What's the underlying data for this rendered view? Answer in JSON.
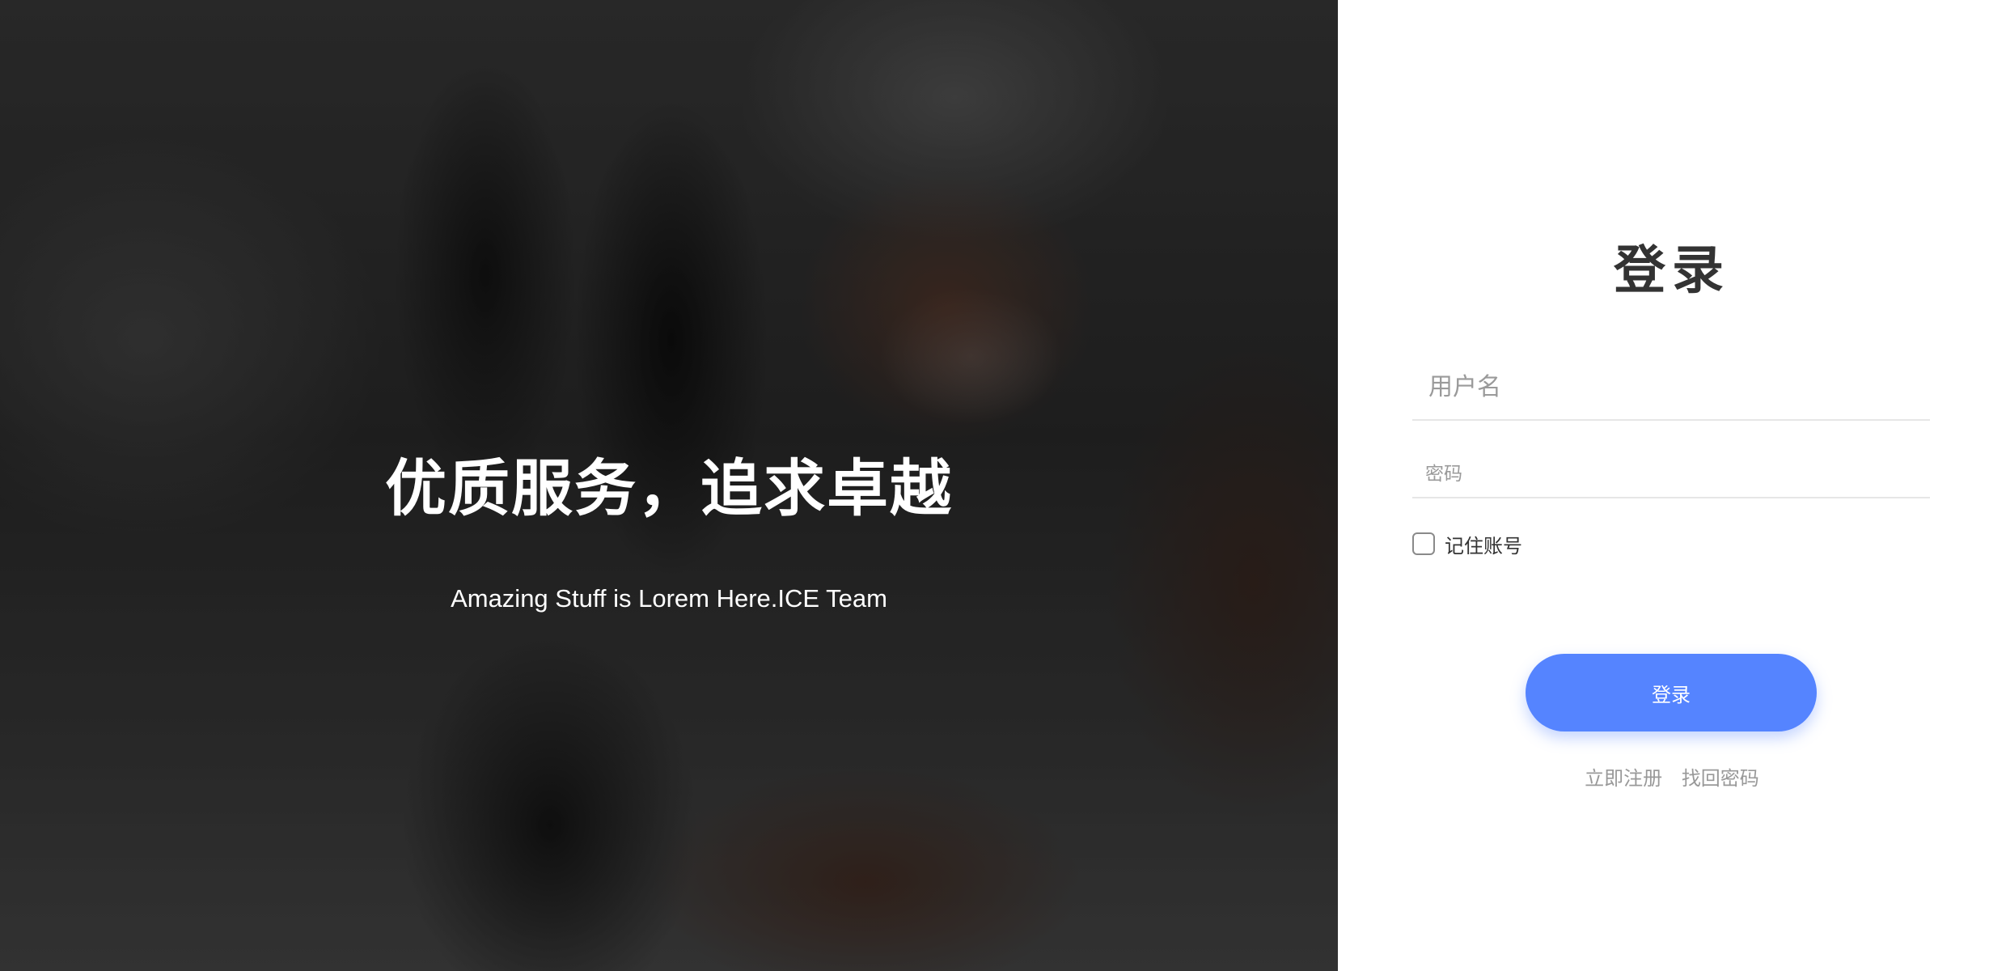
{
  "hero": {
    "title": "优质服务，追求卓越",
    "subtitle": "Amazing Stuff is Lorem Here.ICE Team"
  },
  "login": {
    "title": "登录",
    "username_placeholder": "用户名",
    "username_value": "",
    "password_placeholder": "密码",
    "password_value": "",
    "remember_label": "记住账号",
    "remember_checked": false,
    "submit_label": "登录",
    "register_link": "立即注册",
    "forgot_link": "找回密码"
  },
  "colors": {
    "accent": "#5584ff",
    "panel_bg": "#ffffff",
    "title_text": "#333333",
    "muted_text": "#999999"
  }
}
